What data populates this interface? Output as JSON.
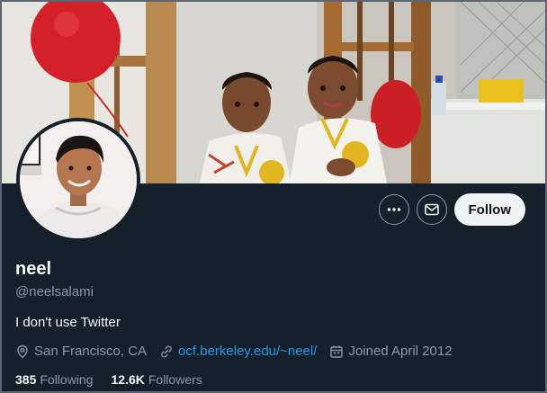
{
  "profile": {
    "name": "neel",
    "handle": "@neelsalami",
    "bio": "I don't use Twitter",
    "location": "San Francisco, CA",
    "website": "ocf.berkeley.edu/~neel/",
    "joined": "Joined April 2012"
  },
  "stats": {
    "following_count": "385",
    "following_label": "Following",
    "followers_count": "12.6K",
    "followers_label": "Followers"
  },
  "actions": {
    "follow_label": "Follow",
    "more_icon": "more-horizontal-icon",
    "message_icon": "envelope-icon"
  },
  "colors": {
    "background": "#15202b",
    "link": "#1d9bf0",
    "secondary_text": "#8b98a5",
    "follow_button": "#eff3f4"
  }
}
